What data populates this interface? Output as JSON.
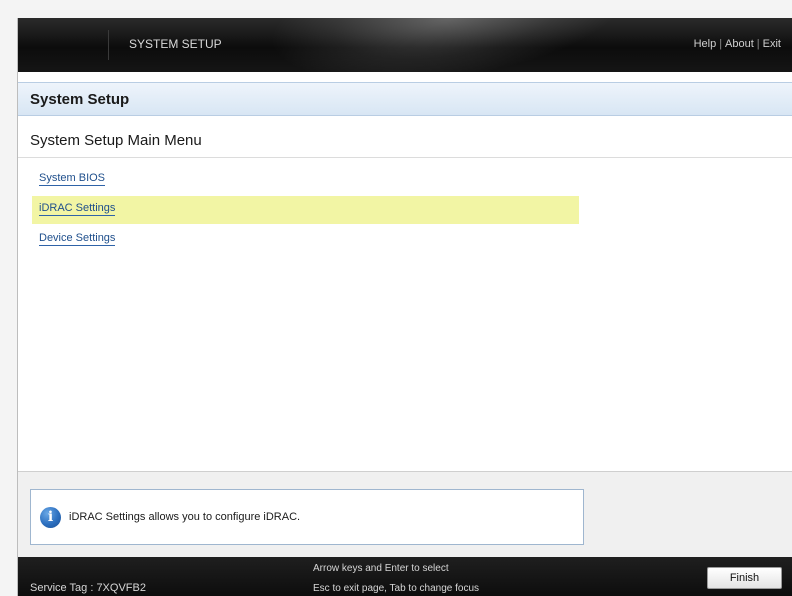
{
  "topbar": {
    "title": "SYSTEM SETUP",
    "links": [
      "Help",
      "About",
      "Exit"
    ],
    "separator": "|"
  },
  "header": {
    "title": "System Setup"
  },
  "main": {
    "menu_title": "System Setup Main Menu",
    "items": [
      {
        "label": "System BIOS",
        "selected": false
      },
      {
        "label": "iDRAC Settings",
        "selected": true
      },
      {
        "label": "Device Settings",
        "selected": false
      }
    ]
  },
  "help": {
    "icon": "info-icon",
    "text": "iDRAC Settings allows you to configure iDRAC."
  },
  "footer": {
    "service_tag": "Service Tag : 7XQVFB2",
    "hint_line1": "Arrow keys and Enter to select",
    "hint_line2": "Esc to exit page, Tab to change focus",
    "finish_label": "Finish"
  },
  "colors": {
    "selected_row": "#f2f5a4",
    "link": "#1f4f8c",
    "header_band": "#d8e6f4",
    "bar_dark": "#0c0c0c"
  }
}
